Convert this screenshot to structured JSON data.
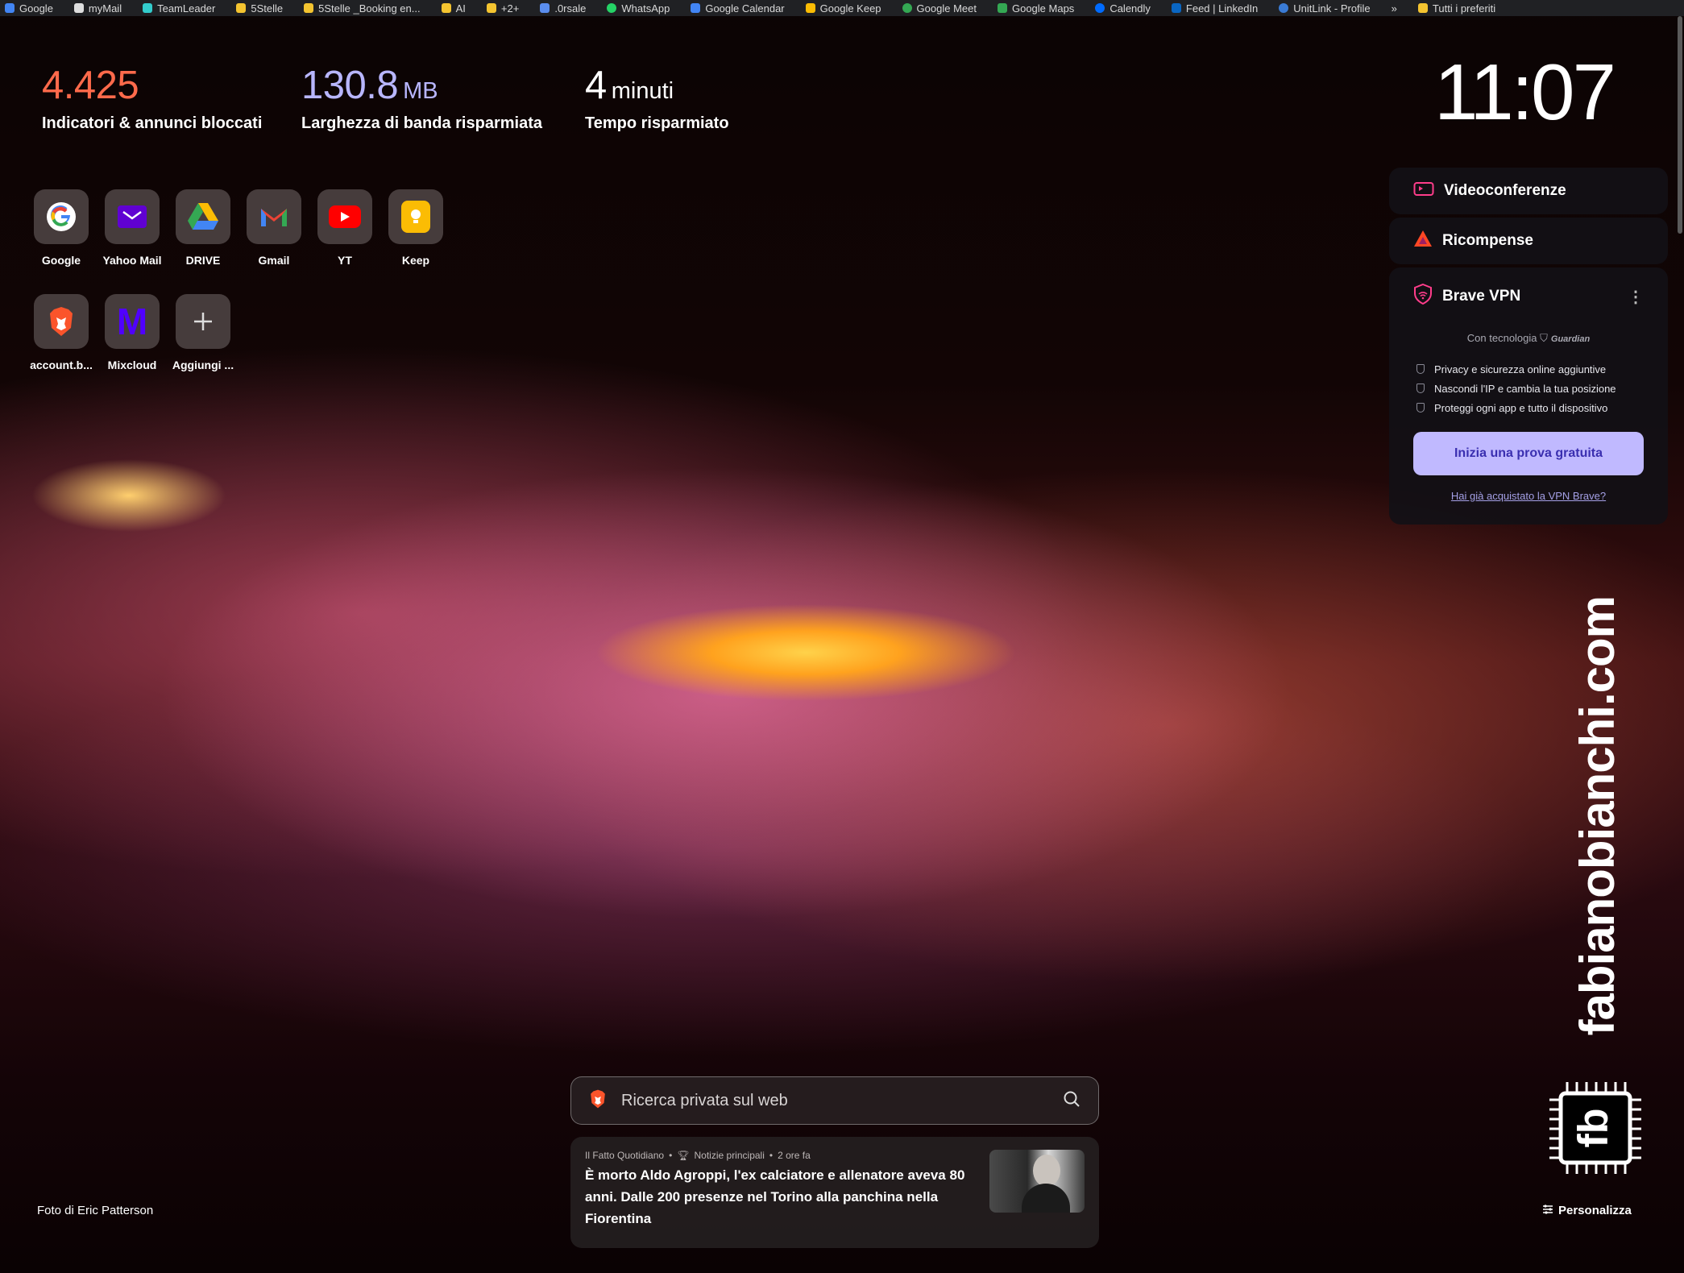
{
  "bookmarks": [
    "Google",
    "myMail",
    "TeamLeader",
    "5Stelle",
    "5Stelle _Booking en...",
    "AI",
    "+2+",
    ".0rsale",
    "WhatsApp",
    "Google Calendar",
    "Google Keep",
    "Google Meet",
    "Google Maps",
    "Calendly",
    "Feed | LinkedIn",
    "UnitLink - Profile",
    "»",
    "Tutti i preferiti"
  ],
  "stats": {
    "trackers": {
      "value": "4.425",
      "label": "Indicatori & annunci bloccati"
    },
    "bandwidth": {
      "value": "130.8",
      "unit": "MB",
      "label": "Larghezza di banda risparmiata"
    },
    "time": {
      "value": "4",
      "unit": "minuti",
      "label": "Tempo risparmiato"
    }
  },
  "clock": "11:07",
  "tiles": [
    {
      "label": "Google"
    },
    {
      "label": "Yahoo Mail"
    },
    {
      "label": "DRIVE"
    },
    {
      "label": "Gmail"
    },
    {
      "label": "YT"
    },
    {
      "label": "Keep"
    },
    {
      "label": "account.b..."
    },
    {
      "label": "Mixcloud"
    },
    {
      "label": "Aggiungi ..."
    }
  ],
  "panel": {
    "video": "Videoconferenze",
    "rewards": "Ricompense",
    "vpn": {
      "title": "Brave VPN",
      "powered": "Con tecnologia",
      "guardian": "Guardian",
      "features": [
        "Privacy e sicurezza online aggiuntive",
        "Nascondi l'IP e cambia la tua posizione",
        "Proteggi ogni app e tutto il dispositivo"
      ],
      "cta": "Inizia una prova gratuita",
      "link": "Hai già acquistato la VPN Brave?"
    }
  },
  "watermark": {
    "text": "fabianobianchi.com",
    "logo": "fb"
  },
  "search": {
    "placeholder": "Ricerca privata sul web"
  },
  "news": {
    "source": "Il Fatto Quotidiano",
    "category": "Notizie principali",
    "time": "2 ore fa",
    "title": "È morto Aldo Agroppi, l'ex calciatore e allenatore aveva 80 anni. Dalle 200 presenze nel Torino alla panchina nella Fiorentina"
  },
  "credit": "Foto di Eric Patterson",
  "customize": "Personalizza",
  "colors": {
    "accent": "#c0b9ff",
    "trackers": "#ff6a4b",
    "bandwidth": "#b8b6ff"
  }
}
